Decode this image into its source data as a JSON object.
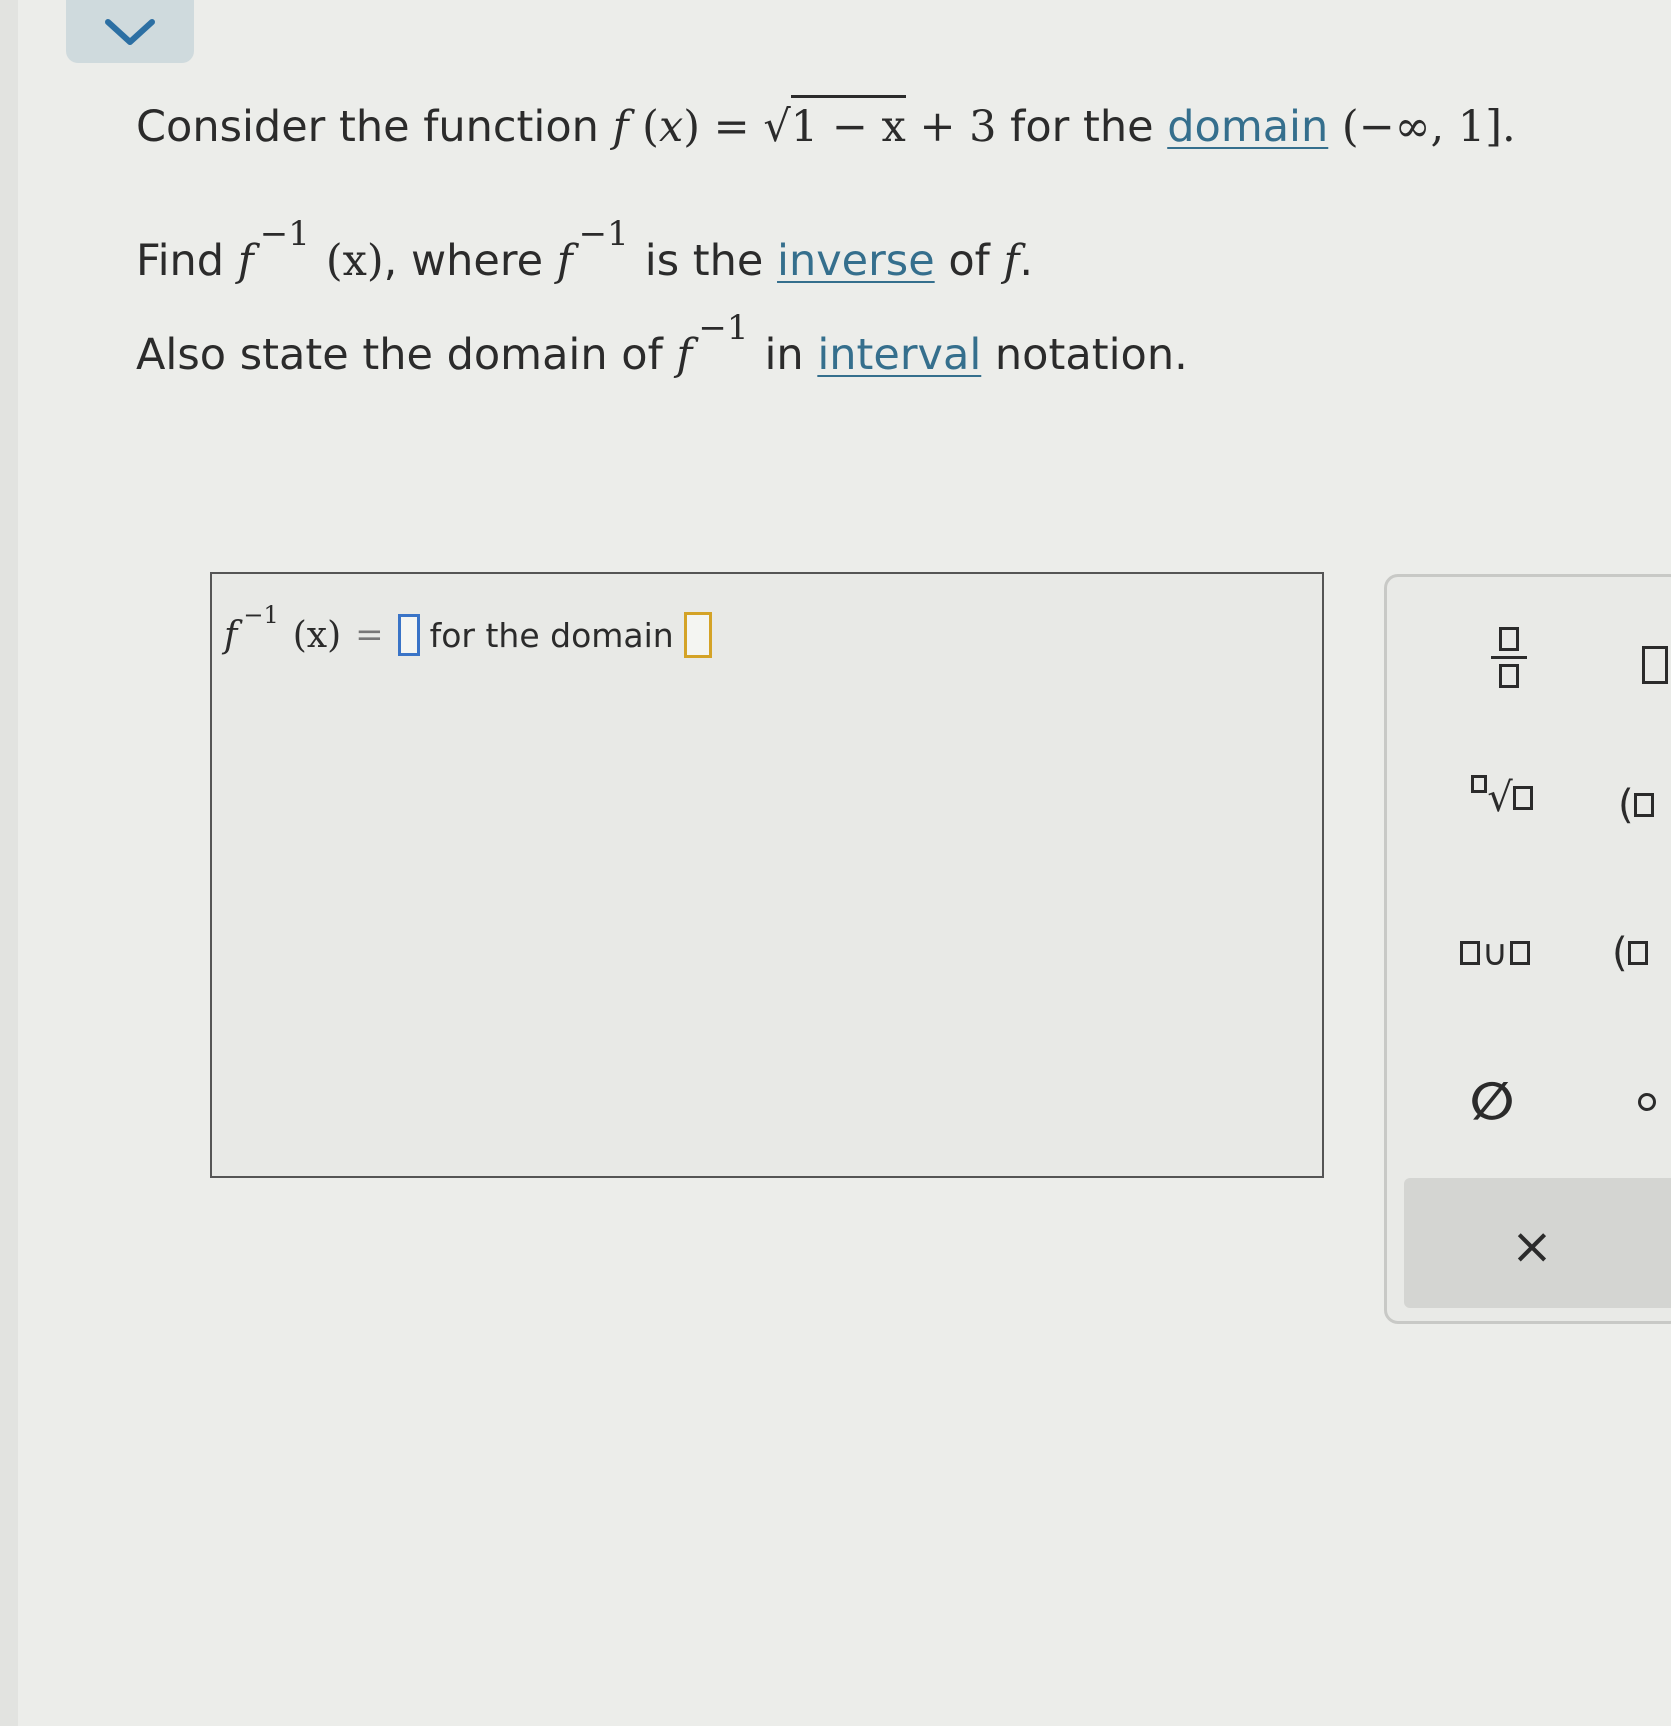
{
  "question": {
    "line1": {
      "prefix": "Consider the function",
      "f": "f",
      "open": " (",
      "x": "x",
      "close": ")",
      "eq": " = ",
      "radical": "√",
      "radicand": "1 − x",
      "plus": " + 3",
      "mid": " for the ",
      "domain_link": "domain",
      "interval": " (−∞, 1].",
      "sep": " "
    },
    "line2": {
      "find": "Find",
      "f1": "f",
      "sup1": "−1",
      "arg": "(x)",
      "where": ", where",
      "f2": "f",
      "sup2": "−1",
      "is_the": "is the",
      "inverse_link": "inverse",
      "of": " of",
      "f3": "f",
      "period": ".",
      "sep": " "
    },
    "line3": {
      "also": "Also state the domain of",
      "f": "f",
      "sup": "−1",
      "in": "in",
      "interval_link": "interval",
      "notation": " notation.",
      "sep": " "
    }
  },
  "answer": {
    "f": "f",
    "sup": "−1",
    "arg": "(x)",
    "eq": "=",
    "for_domain": "for the domain"
  },
  "palette": {
    "union": "∪",
    "empty_set": "∅",
    "clear": "×",
    "paren": "(",
    "radical": "√"
  },
  "colors": {
    "link": "#356f8d",
    "slot_active": "#3a74c7",
    "slot_domain": "#d4a327",
    "chevron": "#2c6fa3"
  },
  "icons": {
    "collapse": "chevron-down-icon",
    "clear": "close-icon"
  }
}
